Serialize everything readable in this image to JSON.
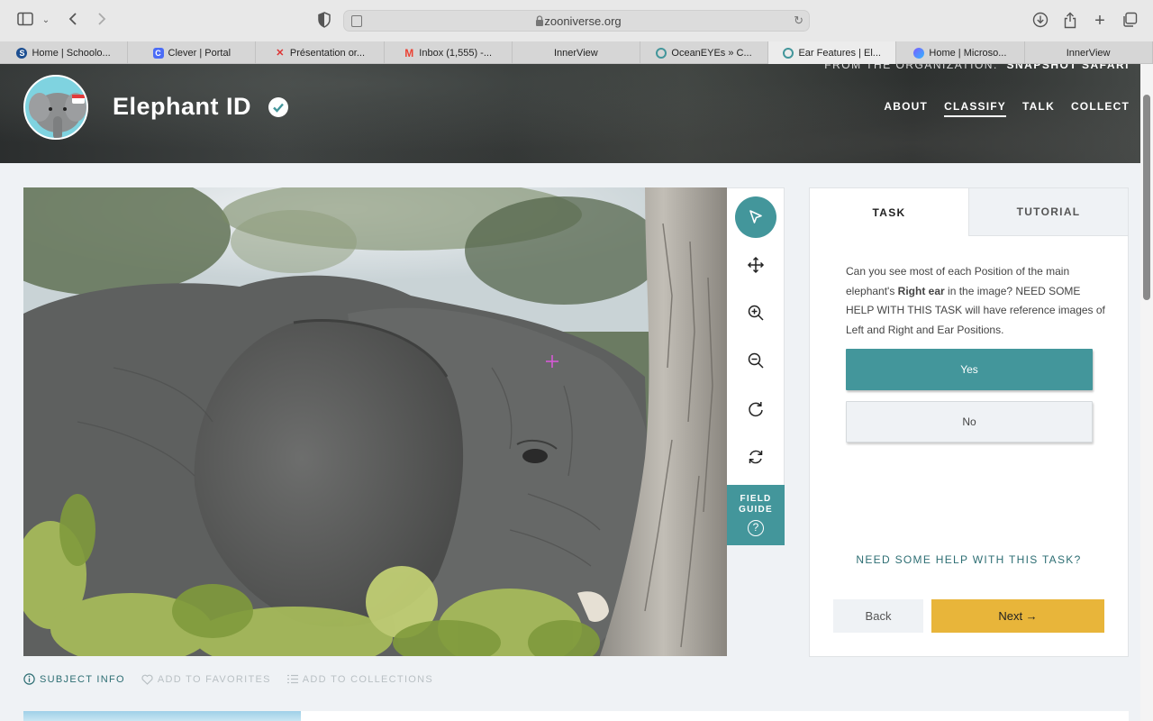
{
  "browser": {
    "url": "zooniverse.org",
    "tabs": [
      {
        "label": "Home | Schoolo...",
        "icon": "schoology-icon",
        "color": "#1d4f91"
      },
      {
        "label": "Clever | Portal",
        "icon": "clever-icon",
        "color": "#4b6cf6"
      },
      {
        "label": "Présentation or...",
        "icon": "slides-icon",
        "color": "#d33"
      },
      {
        "label": "Inbox (1,555) -...",
        "icon": "gmail-icon",
        "color": "#ea4335"
      },
      {
        "label": "InnerView",
        "icon": "",
        "color": ""
      },
      {
        "label": "OceanEYEs » C...",
        "icon": "zooniverse-icon",
        "color": "#43969b"
      },
      {
        "label": "Ear Features | El...",
        "icon": "zooniverse-icon",
        "color": "#43969b"
      },
      {
        "label": "Home | Microso...",
        "icon": "microsoft-icon",
        "color": "#7b5cff"
      },
      {
        "label": "InnerView",
        "icon": "",
        "color": ""
      }
    ],
    "active_tab_index": 6
  },
  "header": {
    "project_title": "Elephant ID",
    "org_prefix": "FROM THE ORGANIZATION:",
    "org_name": "SNAPSHOT SAFARI",
    "nav": [
      "ABOUT",
      "CLASSIFY",
      "TALK",
      "COLLECT"
    ],
    "active_nav": "CLASSIFY"
  },
  "toolbar": {
    "tools": [
      "pointer-icon",
      "move-icon",
      "zoom-in-icon",
      "zoom-out-icon",
      "rotate-icon",
      "reset-icon"
    ],
    "active_tool": "pointer-icon",
    "field_guide_line1": "FIELD",
    "field_guide_line2": "GUIDE",
    "field_guide_help": "?"
  },
  "task_panel": {
    "tabs": [
      "TASK",
      "TUTORIAL"
    ],
    "active_tab": "TASK",
    "question_part1": "Can you see most of each Position of the main elephant's ",
    "question_bold": "Right ear",
    "question_part2": " in the image? NEED SOME HELP WITH THIS TASK will have reference images of Left and Right and Ear Positions.",
    "answers": [
      "Yes",
      "No"
    ],
    "selected_answer": "Yes",
    "help_link": "NEED SOME HELP WITH THIS TASK?",
    "back_label": "Back",
    "next_label": "Next →"
  },
  "subject_actions": {
    "subject_info": "SUBJECT INFO",
    "add_favorites": "ADD TO FAVORITES",
    "add_collections": "ADD TO COLLECTIONS"
  },
  "colors": {
    "accent": "#43969b",
    "next_button": "#e8b53a",
    "link": "#2d6e73"
  }
}
